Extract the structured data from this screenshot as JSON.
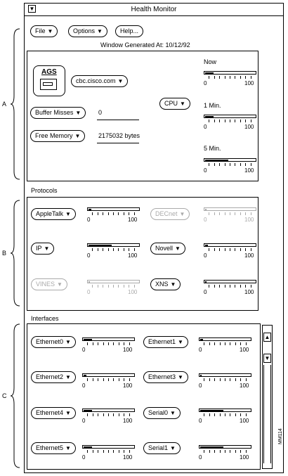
{
  "window": {
    "title": "Health Monitor"
  },
  "menubar": {
    "file": "File",
    "options": "Options",
    "help": "Help..."
  },
  "generated": "Window Generated At: 10/12/92",
  "device": {
    "badge": "AGS",
    "host": "cbc.cisco.com"
  },
  "buffer_misses": {
    "label": "Buffer Misses",
    "value": "0"
  },
  "free_memory": {
    "label": "Free Memory",
    "value": "2175032 bytes"
  },
  "cpu": {
    "label": "CPU",
    "gauges": [
      {
        "label": "Now",
        "fill_pct": 17,
        "min": "0",
        "max": "100"
      },
      {
        "label": "1 Min.",
        "fill_pct": 17,
        "min": "0",
        "max": "100"
      },
      {
        "label": "5 Min.",
        "fill_pct": 45,
        "min": "0",
        "max": "100"
      }
    ]
  },
  "protocols": {
    "heading": "Protocols",
    "items": [
      {
        "label": "AppleTalk",
        "fill_pct": 5,
        "min": "0",
        "max": "100",
        "enabled": true
      },
      {
        "label": "DECnet",
        "fill_pct": 3,
        "min": "0",
        "max": "100",
        "enabled": false
      },
      {
        "label": "IP",
        "fill_pct": 45,
        "min": "0",
        "max": "100",
        "enabled": true
      },
      {
        "label": "Novell",
        "fill_pct": 5,
        "min": "0",
        "max": "100",
        "enabled": true
      },
      {
        "label": "VINES",
        "fill_pct": 3,
        "min": "0",
        "max": "100",
        "enabled": false
      },
      {
        "label": "XNS",
        "fill_pct": 3,
        "min": "0",
        "max": "100",
        "enabled": true
      }
    ]
  },
  "interfaces": {
    "heading": "Interfaces",
    "items": [
      {
        "label": "Ethernet0",
        "fill_pct": 17,
        "min": "0",
        "max": "100"
      },
      {
        "label": "Ethernet1",
        "fill_pct": 5,
        "min": "0",
        "max": "100"
      },
      {
        "label": "Ethernet2",
        "fill_pct": 5,
        "min": "0",
        "max": "100"
      },
      {
        "label": "Ethernet3",
        "fill_pct": 3,
        "min": "0",
        "max": "100"
      },
      {
        "label": "Ethernet4",
        "fill_pct": 17,
        "min": "0",
        "max": "100"
      },
      {
        "label": "Serial0",
        "fill_pct": 45,
        "min": "0",
        "max": "100"
      },
      {
        "label": "Ethernet5",
        "fill_pct": 17,
        "min": "0",
        "max": "100"
      },
      {
        "label": "Serial1",
        "fill_pct": 45,
        "min": "0",
        "max": "100"
      }
    ]
  },
  "side_labels": {
    "a": "A",
    "b": "B",
    "c": "C"
  },
  "figure_id": "MM114"
}
